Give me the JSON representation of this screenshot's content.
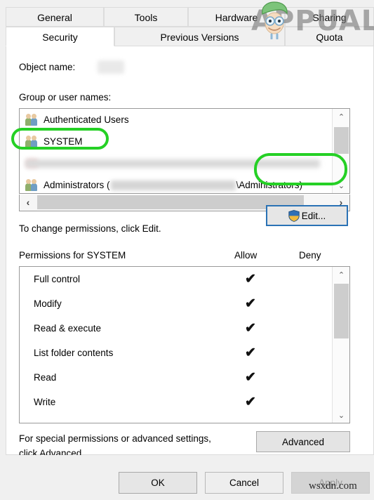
{
  "dialog": {
    "tabs_row1": [
      {
        "label": "General",
        "active": false
      },
      {
        "label": "Tools",
        "active": false
      },
      {
        "label": "Hardware",
        "active": false
      },
      {
        "label": "Sharing",
        "active": false
      }
    ],
    "tabs_row2": [
      {
        "label": "Security",
        "active": true
      },
      {
        "label": "Previous Versions",
        "active": false
      },
      {
        "label": "Quota",
        "active": false
      }
    ],
    "object_name_label": "Object name:",
    "object_name_value": "",
    "group_label": "Group or user names:",
    "users": [
      {
        "name": "Authenticated Users",
        "blurred": false,
        "highlighted": false
      },
      {
        "name": "SYSTEM",
        "blurred": false,
        "highlighted": true
      },
      {
        "name": "",
        "blurred": true,
        "highlighted": false
      },
      {
        "name_prefix": "Administrators (",
        "name_suffix": "\\Administrators)",
        "blurred_middle": true,
        "highlighted": false
      }
    ],
    "edit_hint": "To change permissions, click Edit.",
    "edit_button": "Edit...",
    "permissions_label": "Permissions for SYSTEM",
    "allow_header": "Allow",
    "deny_header": "Deny",
    "permissions": [
      {
        "name": "Full control",
        "allow": "✔",
        "deny": ""
      },
      {
        "name": "Modify",
        "allow": "✔",
        "deny": ""
      },
      {
        "name": "Read & execute",
        "allow": "✔",
        "deny": ""
      },
      {
        "name": "List folder contents",
        "allow": "✔",
        "deny": ""
      },
      {
        "name": "Read",
        "allow": "✔",
        "deny": ""
      },
      {
        "name": "Write",
        "allow": "✔",
        "deny": ""
      }
    ],
    "advanced_hint_line1": "For special permissions or advanced settings,",
    "advanced_hint_line2": "click Advanced.",
    "advanced_button": "Advanced",
    "ok_button": "OK",
    "cancel_button": "Cancel",
    "apply_button": "Apply",
    "scroll_up_icon": "⌃",
    "scroll_down_icon": "⌄",
    "scroll_left_icon": "‹",
    "scroll_right_icon": "›"
  },
  "watermarks": {
    "appuals": "APPUALS",
    "wsxdn": "wsxdn.com"
  },
  "colors": {
    "annotation_green": "#25d025",
    "edit_focus_blue": "#2a72b5",
    "shield_blue": "#2f6fb5",
    "shield_yellow": "#f0b93c"
  }
}
